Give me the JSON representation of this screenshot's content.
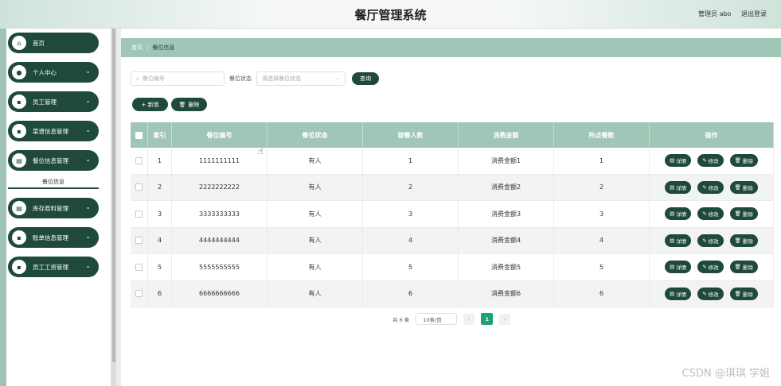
{
  "header": {
    "title": "餐厅管理系统",
    "user": "管理员 abo",
    "logout": "退出登录"
  },
  "sidebar": {
    "items": [
      {
        "label": "首页",
        "icon": "home-icon",
        "glyph": "⌂",
        "chev": ""
      },
      {
        "label": "个人中心",
        "icon": "user-icon",
        "glyph": "●",
        "chev": "⌄"
      },
      {
        "label": "员工管理",
        "icon": "grid-icon",
        "glyph": "▪",
        "chev": "⌄"
      },
      {
        "label": "菜谱信息管理",
        "icon": "grid-icon",
        "glyph": "▪",
        "chev": "⌄"
      },
      {
        "label": "餐位信息管理",
        "icon": "seat-icon",
        "glyph": "▤",
        "chev": "⌄"
      },
      {
        "label": "库存原料管理",
        "icon": "stock-icon",
        "glyph": "▤",
        "chev": "⌄"
      },
      {
        "label": "账单信息管理",
        "icon": "grid-icon",
        "glyph": "▪",
        "chev": "⌄"
      },
      {
        "label": "员工工资管理",
        "icon": "grid-icon",
        "glyph": "▪",
        "chev": "⌄"
      }
    ],
    "submenu": "餐位信息"
  },
  "breadcrumb": {
    "home": "首页",
    "sep": "/",
    "current": "餐位信息"
  },
  "search": {
    "seat_placeholder": "餐位编号",
    "status_label": "餐位状态",
    "status_placeholder": "请选择餐位状态",
    "query": "查询"
  },
  "actions": {
    "add": "+ 新增",
    "delete": "删除"
  },
  "table": {
    "headers": [
      "索引",
      "餐位编号",
      "餐位状态",
      "就餐人数",
      "消费金额",
      "所点餐数",
      "操作"
    ],
    "rows": [
      {
        "idx": "1",
        "no": "1111111111",
        "status": "有人",
        "people": "1",
        "amount": "消费金额1",
        "dishes": "1"
      },
      {
        "idx": "2",
        "no": "2222222222",
        "status": "有人",
        "people": "2",
        "amount": "消费金额2",
        "dishes": "2"
      },
      {
        "idx": "3",
        "no": "3333333333",
        "status": "有人",
        "people": "3",
        "amount": "消费金额3",
        "dishes": "3"
      },
      {
        "idx": "4",
        "no": "4444444444",
        "status": "有人",
        "people": "4",
        "amount": "消费金额4",
        "dishes": "4"
      },
      {
        "idx": "5",
        "no": "5555555555",
        "status": "有人",
        "people": "5",
        "amount": "消费金额5",
        "dishes": "5"
      },
      {
        "idx": "6",
        "no": "6666666666",
        "status": "有人",
        "people": "6",
        "amount": "消费金额6",
        "dishes": "6"
      }
    ],
    "ops": {
      "detail": "详情",
      "edit": "修改",
      "delete": "删除"
    }
  },
  "pager": {
    "total": "共 6 条",
    "size": "10条/页",
    "prev": "‹",
    "next": "›",
    "page": "1"
  },
  "watermark": "CSDN @琪琪 学姐",
  "colors": {
    "accent": "#1f4a3a",
    "header_bg": "#9fc6b6",
    "page_active": "#19a17a"
  }
}
